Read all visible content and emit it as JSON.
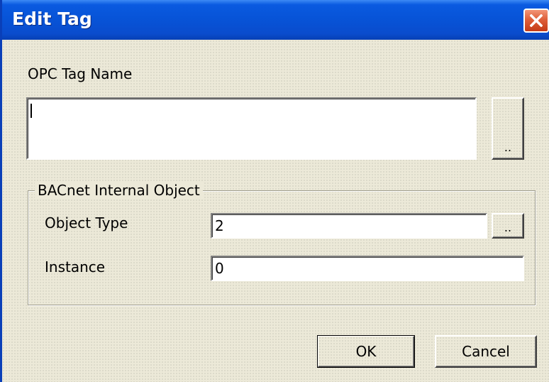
{
  "window": {
    "title": "Edit Tag",
    "close_icon": "close-icon"
  },
  "opc_tag": {
    "label": "OPC Tag Name",
    "value": "",
    "browse_label": ".."
  },
  "bacnet_group": {
    "legend": "BACnet Internal Object",
    "object_type": {
      "label": "Object Type",
      "value": "2",
      "browse_label": ".."
    },
    "instance": {
      "label": "Instance",
      "value": "0"
    }
  },
  "buttons": {
    "ok_label": "OK",
    "cancel_label": "Cancel"
  },
  "colors": {
    "titlebar": "#0754d8",
    "close_button": "#de5f3a",
    "dialog_background": "#ece9d8"
  }
}
